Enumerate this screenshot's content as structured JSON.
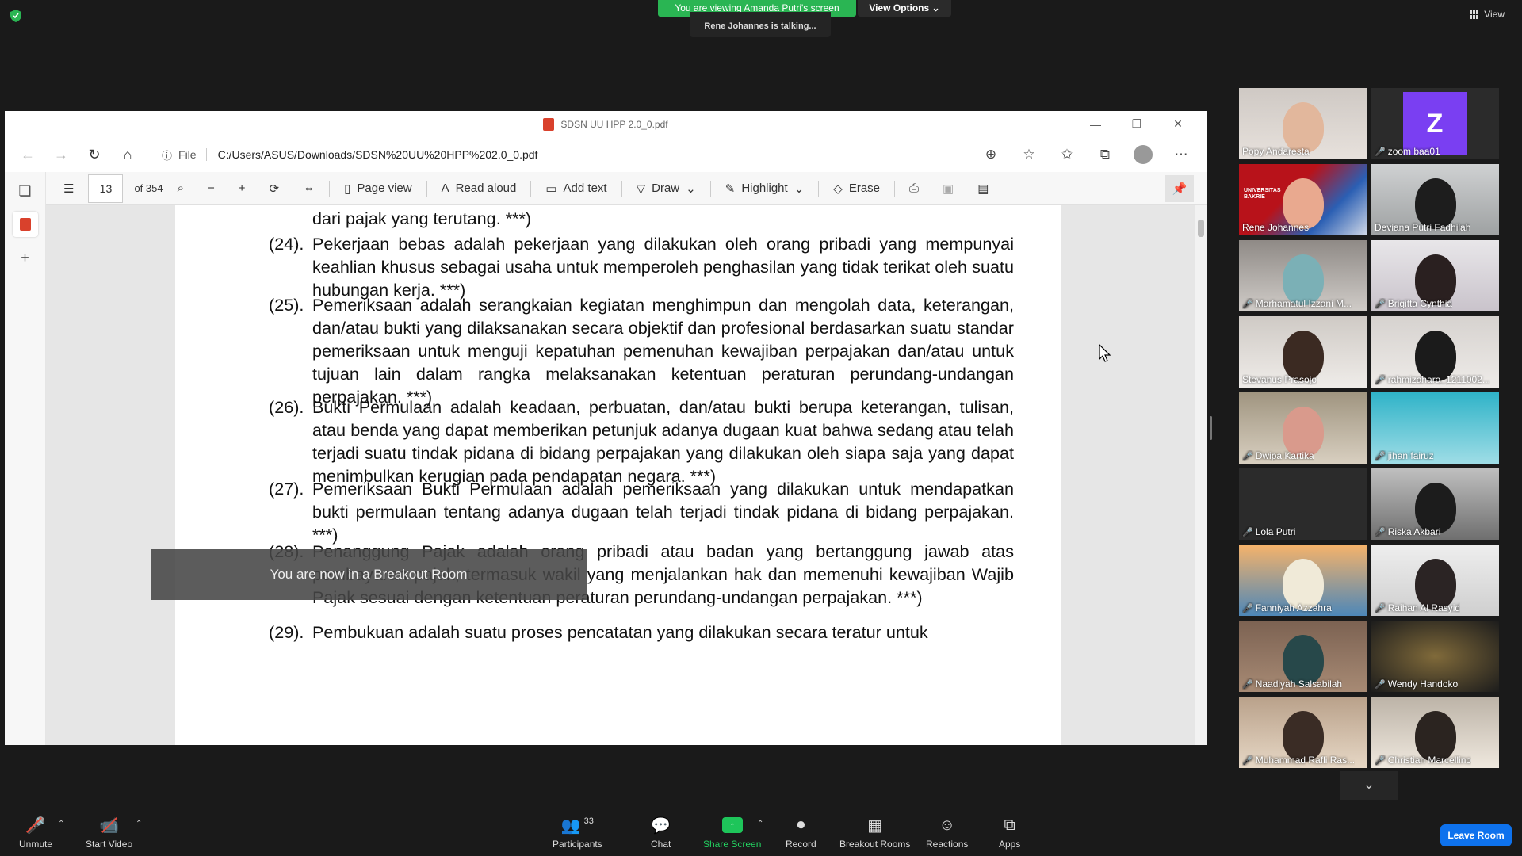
{
  "banner": {
    "viewing": "You are viewing Amanda Putri's screen",
    "view_options": "View Options",
    "talking": "Rene Johannes is talking...",
    "view": "View"
  },
  "browser": {
    "title": "SDSN UU HPP 2.0_0.pdf",
    "file_label": "File",
    "url": "C:/Users/ASUS/Downloads/SDSN%20UU%20HPP%202.0_0.pdf"
  },
  "pdf_toolbar": {
    "page": "13",
    "of": "of 354",
    "page_view": "Page view",
    "read_aloud": "Read aloud",
    "add_text": "Add text",
    "draw": "Draw",
    "highlight": "Highlight",
    "erase": "Erase"
  },
  "document": {
    "paragraphs": [
      {
        "num": "",
        "text": "dari pajak yang terutang. ***)"
      },
      {
        "num": "(24).",
        "text": "Pekerjaan bebas adalah pekerjaan yang dilakukan oleh orang pribadi yang mempunyai keahlian khusus sebagai usaha untuk memperoleh penghasilan yang tidak terikat oleh suatu hubungan kerja. ***)"
      },
      {
        "num": "(25).",
        "text": "Pemeriksaan adalah serangkaian kegiatan menghimpun dan mengolah data, keterangan, dan/atau bukti yang dilaksanakan secara objektif dan profesional berdasarkan suatu standar pemeriksaan untuk menguji kepatuhan pemenuhan kewajiban perpajakan dan/atau untuk tujuan lain dalam rangka melaksanakan ketentuan peraturan perundang-undangan perpajakan. ***)"
      },
      {
        "num": "(26).",
        "text": "Bukti Permulaan adalah keadaan, perbuatan, dan/atau bukti berupa keterangan, tulisan, atau benda yang dapat memberikan petunjuk adanya dugaan kuat bahwa sedang atau telah terjadi suatu tindak pidana di bidang perpajakan yang dilakukan oleh siapa saja yang dapat menimbulkan kerugian pada pendapatan negara. ***)"
      },
      {
        "num": "(27).",
        "text": "Pemeriksaan Bukti Permulaan adalah pemeriksaan yang dilakukan untuk mendapatkan bukti permulaan tentang adanya dugaan telah terjadi tindak pidana di bidang perpajakan. ***)"
      },
      {
        "num": "(28).",
        "text": "Penanggung Pajak adalah orang pribadi atau badan yang bertanggung jawab atas pembayaran pajak, termasuk wakil yang menjalankan hak dan memenuhi kewajiban Wajib Pajak sesuai dengan ketentuan peraturan perundang-undangan perpajakan. ***)"
      },
      {
        "num": "(29).",
        "text": "Pembukuan adalah suatu proses pencatatan yang dilakukan secara teratur untuk"
      }
    ]
  },
  "breakout_notice": "You are now in a Breakout Room",
  "participants": [
    {
      "name": "Popy Andaresta",
      "muted": false
    },
    {
      "name": "zoom baa01",
      "muted": true
    },
    {
      "name": "Rene Johannes",
      "muted": false,
      "active": true
    },
    {
      "name": "Deviana Putri Fadhilah",
      "muted": false
    },
    {
      "name": "Marhamatul Izzani M...",
      "muted": true
    },
    {
      "name": "Brigitta Cynthia",
      "muted": true
    },
    {
      "name": "Stevanus Prasojo",
      "muted": false
    },
    {
      "name": "rahmizahara_1211002...",
      "muted": true
    },
    {
      "name": "Dwipa Kartika",
      "muted": true
    },
    {
      "name": "jihan fairuz",
      "muted": true
    },
    {
      "name": "Lola Putri",
      "muted": true
    },
    {
      "name": "Riska Akbari",
      "muted": true
    },
    {
      "name": "Fanniyah Azzahra",
      "muted": true
    },
    {
      "name": "Raihan Al Rasyid",
      "muted": true
    },
    {
      "name": "Naadiyah Salsabilah",
      "muted": true
    },
    {
      "name": "Wendy Handoko",
      "muted": true
    },
    {
      "name": "Muhammad Rafli Ras...",
      "muted": true
    },
    {
      "name": "Christian Marcellino",
      "muted": true
    }
  ],
  "tile_ui": {
    "avatar_letter": "Z",
    "logo_text": "UNIVERSITAS BAKRIE"
  },
  "bottom_bar": {
    "unmute": "Unmute",
    "start_video": "Start Video",
    "participants": "Participants",
    "participant_count": "33",
    "chat": "Chat",
    "share_screen": "Share Screen",
    "record": "Record",
    "breakout_rooms": "Breakout Rooms",
    "reactions": "Reactions",
    "apps": "Apps",
    "leave": "Leave Room"
  },
  "colors": {
    "green": "#2ab553",
    "blue": "#0e72ed",
    "active_outline": "#f7d21d",
    "pdf_red": "#d9412c"
  }
}
